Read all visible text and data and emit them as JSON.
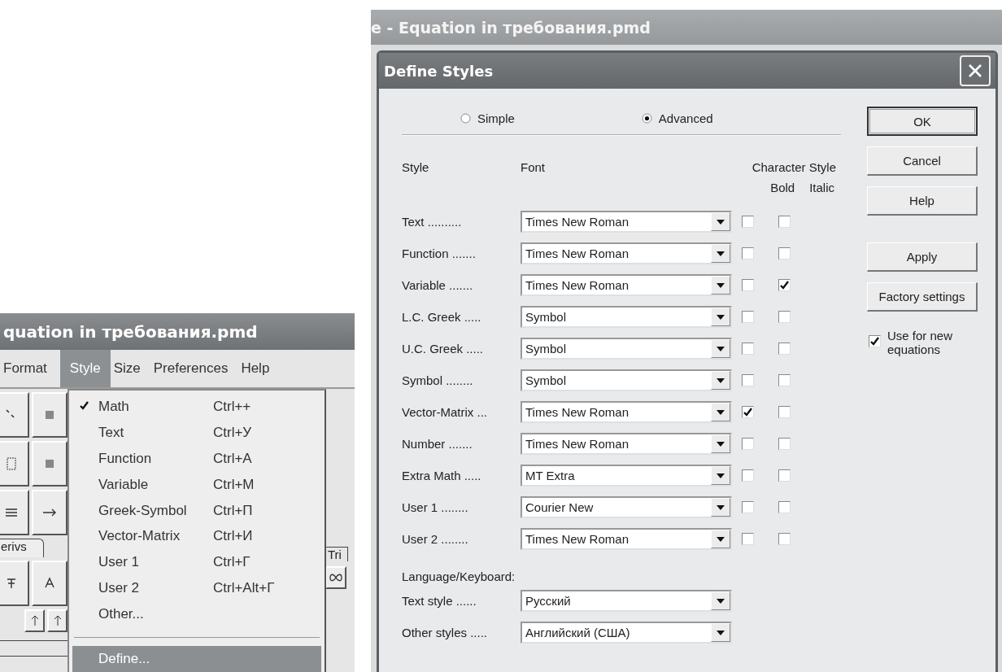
{
  "left_window": {
    "title": "quation in требования.pmd",
    "menu_bar": [
      {
        "label": "Format",
        "selected": false
      },
      {
        "label": "Style",
        "selected": true
      },
      {
        "label": "Size",
        "selected": false
      },
      {
        "label": "Preferences",
        "selected": false
      },
      {
        "label": "Help",
        "selected": false
      }
    ],
    "palette_tabs": [
      "erivs",
      "Tri"
    ],
    "style_menu": [
      {
        "kind": "item",
        "label": "Math",
        "shortcut": "Ctrl++",
        "checked": true,
        "selected": false
      },
      {
        "kind": "item",
        "label": "Text",
        "shortcut": "Ctrl+У",
        "checked": false,
        "selected": false
      },
      {
        "kind": "item",
        "label": "Function",
        "shortcut": "Ctrl+А",
        "checked": false,
        "selected": false
      },
      {
        "kind": "item",
        "label": "Variable",
        "shortcut": "Ctrl+М",
        "checked": false,
        "selected": false
      },
      {
        "kind": "item",
        "label": "Greek-Symbol",
        "shortcut": "Ctrl+П",
        "checked": false,
        "selected": false
      },
      {
        "kind": "item",
        "label": "Vector-Matrix",
        "shortcut": "Ctrl+И",
        "checked": false,
        "selected": false
      },
      {
        "kind": "item",
        "label": "User 1",
        "shortcut": "Ctrl+Г",
        "checked": false,
        "selected": false
      },
      {
        "kind": "item",
        "label": "User 2",
        "shortcut": "Ctrl+Alt+Г",
        "checked": false,
        "selected": false
      },
      {
        "kind": "item",
        "label": "Other...",
        "checked": false,
        "selected": false
      },
      {
        "kind": "separator"
      },
      {
        "kind": "item",
        "label": "Define...",
        "checked": false,
        "selected": true
      }
    ]
  },
  "right_window": {
    "title": "e - Equation in требования.pmd",
    "dialog": {
      "title": "Define Styles",
      "modes": [
        {
          "label": "Simple",
          "selected": false
        },
        {
          "label": "Advanced",
          "selected": true
        }
      ],
      "columns": {
        "style": "Style",
        "font": "Font",
        "character_style": "Character Style",
        "bold": "Bold",
        "italic": "Italic"
      },
      "styles": [
        {
          "label": "Text ..........",
          "font": "Times New Roman",
          "bold": false,
          "italic": false
        },
        {
          "label": "Function .......",
          "font": "Times New Roman",
          "bold": false,
          "italic": false
        },
        {
          "label": "Variable .......",
          "font": "Times New Roman",
          "bold": false,
          "italic": true
        },
        {
          "label": "L.C. Greek .....",
          "font": "Symbol",
          "bold": false,
          "italic": false
        },
        {
          "label": "U.C. Greek .....",
          "font": "Symbol",
          "bold": false,
          "italic": false
        },
        {
          "label": "Symbol ........",
          "font": "Symbol",
          "bold": false,
          "italic": false
        },
        {
          "label": "Vector-Matrix ...",
          "font": "Times New Roman",
          "bold": true,
          "italic": false
        },
        {
          "label": "Number .......",
          "font": "Times New Roman",
          "bold": false,
          "italic": false
        },
        {
          "label": "Extra Math .....",
          "font": "MT Extra",
          "bold": false,
          "italic": false
        },
        {
          "label": "User 1 ........",
          "font": "Courier New",
          "bold": false,
          "italic": false
        },
        {
          "label": "User 2 ........",
          "font": "Times New Roman",
          "bold": false,
          "italic": false
        }
      ],
      "language_heading": "Language/Keyboard:",
      "language": [
        {
          "label": "Text style ......",
          "value": "Русский"
        },
        {
          "label": "Other styles .....",
          "value": "Английский (США)"
        }
      ],
      "button_groups": [
        [
          {
            "label": "OK",
            "default": true
          },
          {
            "label": "Cancel",
            "default": false
          },
          {
            "label": "Help",
            "default": false
          }
        ],
        [
          {
            "label": "Apply",
            "default": false
          },
          {
            "label": "Factory settings",
            "default": false
          }
        ]
      ],
      "use_for_new": {
        "label": "Use for new equations",
        "checked": true
      }
    }
  }
}
